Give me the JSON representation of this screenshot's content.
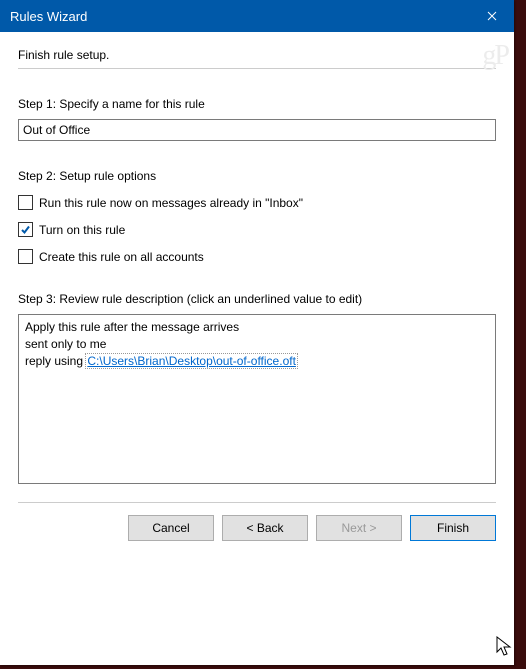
{
  "window": {
    "title": "Rules Wizard"
  },
  "header": {
    "instruction": "Finish rule setup."
  },
  "step1": {
    "label": "Step 1: Specify a name for this rule",
    "value": "Out of Office"
  },
  "step2": {
    "label": "Step 2: Setup rule options",
    "opt_run_now": {
      "label": "Run this rule now on messages already in \"Inbox\"",
      "checked": false
    },
    "opt_turn_on": {
      "label": "Turn on this rule",
      "checked": true
    },
    "opt_all_accounts": {
      "label": "Create this rule on all accounts",
      "checked": false
    }
  },
  "step3": {
    "label": "Step 3: Review rule description (click an underlined value to edit)",
    "line1": "Apply this rule after the message arrives",
    "line2": "sent only to me",
    "line3_prefix": "reply using ",
    "line3_link": "C:\\Users\\Brian\\Desktop\\out-of-office.oft"
  },
  "buttons": {
    "cancel": "Cancel",
    "back": "< Back",
    "next": "Next >",
    "finish": "Finish"
  },
  "watermark": "gP"
}
